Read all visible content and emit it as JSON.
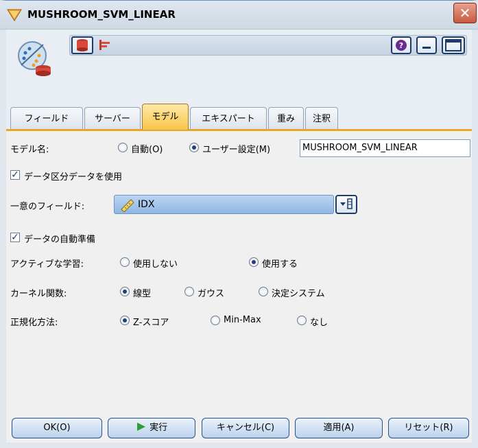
{
  "window": {
    "title": "MUSHROOM_SVM_LINEAR",
    "close_glyph": "✕"
  },
  "toolbar": {
    "help_glyph": "?"
  },
  "tabs": [
    {
      "label": "フィールド"
    },
    {
      "label": "サーバー"
    },
    {
      "label": "モデル",
      "active": true
    },
    {
      "label": "エキスパート"
    },
    {
      "label": "重み"
    },
    {
      "label": "注釈"
    }
  ],
  "model_name": {
    "label": "モデル名:",
    "option_auto": "自動(O)",
    "option_user": "ユーザー設定(M)",
    "selected": "user",
    "value": "MUSHROOM_SVM_LINEAR"
  },
  "use_partition": {
    "label": "データ区分データを使用",
    "checked": true
  },
  "unique_field": {
    "label": "一意のフィールド:",
    "value": "IDX"
  },
  "auto_prep": {
    "label": "データの自動準備",
    "checked": true
  },
  "active_learning": {
    "label": "アクティブな学習:",
    "option_off": "使用しない",
    "option_on": "使用する",
    "selected": "on"
  },
  "kernel": {
    "label": "カーネル関数:",
    "option_linear": "線型",
    "option_gauss": "ガウス",
    "option_decision": "決定システム",
    "selected": "linear"
  },
  "normalization": {
    "label": "正規化方法:",
    "option_z": "Z-スコア",
    "option_minmax": "Min-Max",
    "option_none": "なし",
    "selected": "z"
  },
  "buttons": {
    "ok": "OK(O)",
    "run": "実行",
    "cancel": "キャンセル(C)",
    "apply": "適用(A)",
    "reset": "リセット(R)"
  },
  "colors": {
    "active_tab": "#f7c54a",
    "tab_underline": "#e8a826",
    "field_box": "#8fb7e3",
    "run_icon": "#2e9e3a"
  }
}
